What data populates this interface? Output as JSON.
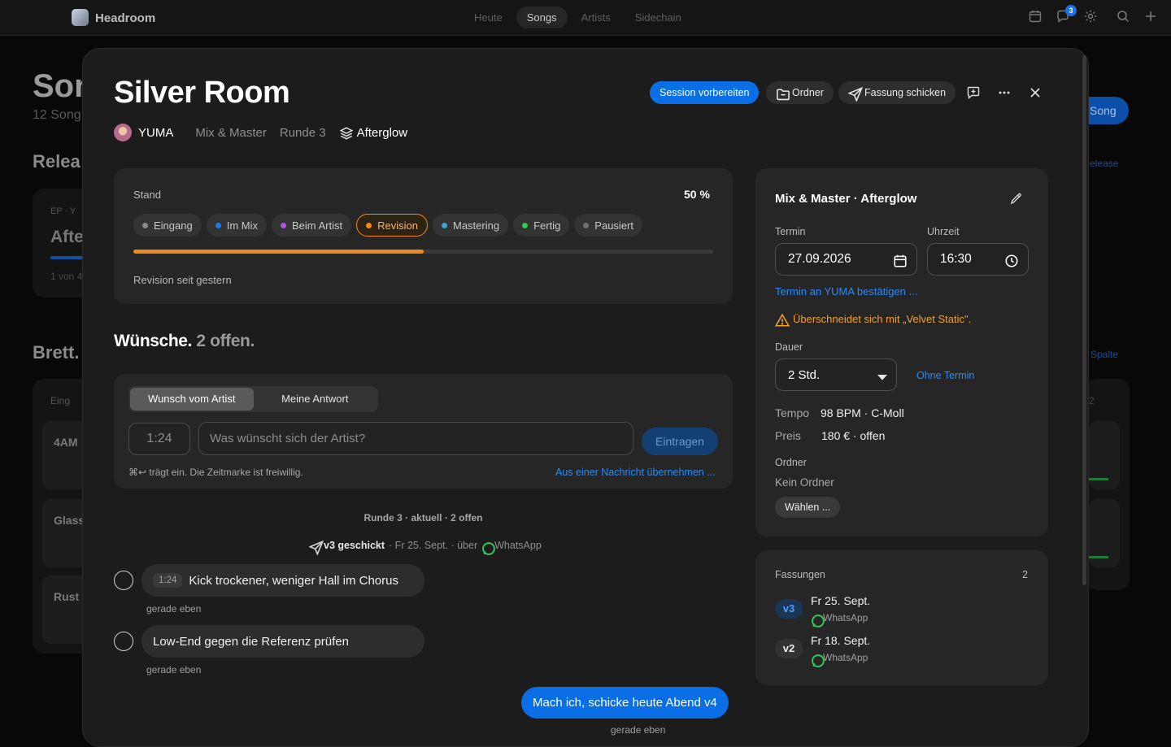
{
  "app": {
    "name": "Headroom"
  },
  "nav": {
    "items": [
      "Heute",
      "Songs",
      "Artists",
      "Sidechain"
    ],
    "active": "Songs"
  },
  "notifications": {
    "count": "3"
  },
  "background": {
    "title": "Sor",
    "subtitle": "12 Song",
    "releases_heading": "Relea",
    "release_card": {
      "kicker": "EP · Y",
      "title": "Afte",
      "count": "1 von 4"
    },
    "new_song_button": "Song",
    "release_link": "elease",
    "board_heading": "Brett.",
    "board_column": "Eing",
    "board_link": "Spalte",
    "board_count": "2",
    "board_cards": [
      "4AM",
      "Glass",
      "Rust"
    ]
  },
  "song": {
    "title": "Silver Room",
    "artist": "YUMA",
    "phase": "Mix & Master",
    "round": "Runde 3",
    "release": "Afterglow"
  },
  "actions": {
    "prepare_session": "Session vorbereiten",
    "folder": "Ordner",
    "send_version": "Fassung schicken"
  },
  "status": {
    "label": "Stand",
    "percent": "50 %",
    "progress": 0.5,
    "stages": [
      {
        "label": "Eingang",
        "color": "#8a8a8a"
      },
      {
        "label": "Im Mix",
        "color": "#1a7cf5"
      },
      {
        "label": "Beim Artist",
        "color": "#b453e0"
      },
      {
        "label": "Revision",
        "color": "#f08a1e",
        "active": true
      },
      {
        "label": "Mastering",
        "color": "#36a8d8"
      },
      {
        "label": "Fertig",
        "color": "#34c759"
      },
      {
        "label": "Pausiert",
        "color": "#6f6f6f"
      }
    ],
    "note": "Revision seit gestern"
  },
  "wishes": {
    "heading": "Wünsche.",
    "open_text": "2 offen.",
    "tabs": [
      "Wunsch vom Artist",
      "Meine Antwort"
    ],
    "time_value": "1:24",
    "input_placeholder": "Was wünscht sich der Artist?",
    "submit_label": "Eintragen",
    "hint": "⌘↩ trägt ein. Die Zeitmarke ist freiwillig.",
    "import_link": "Aus einer Nachricht übernehmen ...",
    "round_info": "Runde 3 · aktuell · 2 offen",
    "sent": {
      "label": "v3 geschickt",
      "details": "· Fr 25. Sept. · über",
      "channel": "WhatsApp"
    },
    "items": [
      {
        "timestamp": "1:24",
        "text": "Kick trockener, weniger Hall im Chorus",
        "time": "gerade eben"
      },
      {
        "timestamp": "",
        "text": "Low-End gegen die Referenz prüfen",
        "time": "gerade eben"
      }
    ],
    "reply": {
      "text": "Mach ich, schicke heute Abend v4",
      "time": "gerade eben"
    }
  },
  "session": {
    "title": "Mix & Master · Afterglow",
    "date_label": "Termin",
    "date_value": "27.09.2026",
    "time_label": "Uhrzeit",
    "time_value": "16:30",
    "confirm_link": "Termin an YUMA bestätigen ...",
    "warning": "Überschneidet sich mit „Velvet Static\".",
    "duration_label": "Dauer",
    "duration_value": "2 Std.",
    "no_date_link": "Ohne Termin",
    "tempo_label": "Tempo",
    "tempo_value": "98 BPM · C-Moll",
    "price_label": "Preis",
    "price_value": "180 € · offen",
    "folder_label": "Ordner",
    "folder_value": "Kein Ordner",
    "choose_button": "Wählen ..."
  },
  "versions": {
    "label": "Fassungen",
    "count": "2",
    "items": [
      {
        "badge": "v3",
        "date": "Fr 25. Sept.",
        "channel": "WhatsApp"
      },
      {
        "badge": "v2",
        "date": "Fr 18. Sept.",
        "channel": "WhatsApp"
      }
    ]
  },
  "colors": {
    "accent": "#0a6fe6",
    "revision": "#f08a1e",
    "warning": "#f0a030",
    "whatsapp": "#34c759"
  }
}
